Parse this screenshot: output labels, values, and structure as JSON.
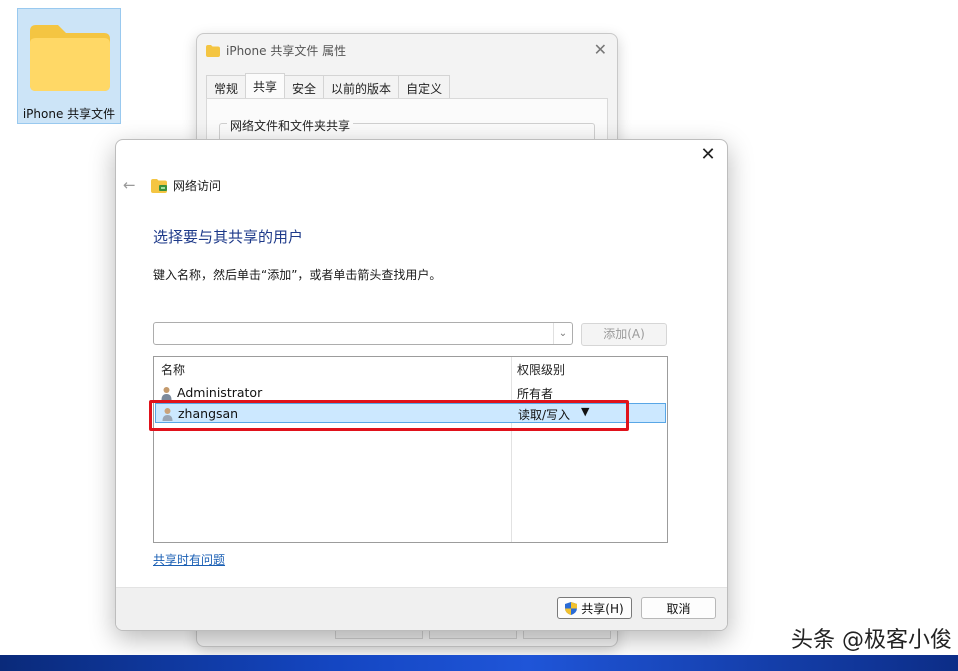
{
  "desktop": {
    "folder_label": "iPhone 共享文件"
  },
  "properties_dialog": {
    "title": "iPhone 共享文件 属性",
    "tabs": [
      "常规",
      "共享",
      "安全",
      "以前的版本",
      "自定义"
    ],
    "active_tab": "共享",
    "group_label": "网络文件和文件夹共享"
  },
  "wizard": {
    "breadcrumb": "网络访问",
    "heading": "选择要与其共享的用户",
    "instruction": "键入名称，然后单击“添加”，或者单击箭头查找用户。",
    "name_input_value": "",
    "add_button": "添加(A)",
    "columns": {
      "name": "名称",
      "permission": "权限级别"
    },
    "users": [
      {
        "name": "Administrator",
        "permission": "所有者"
      },
      {
        "name": "zhangsan",
        "permission": "读取/写入",
        "selected": true
      }
    ],
    "help_link": "共享时有问题",
    "share_button": "共享(H)",
    "cancel_button": "取消"
  },
  "watermark": {
    "text": "头条 @极客小俊"
  },
  "colors": {
    "highlight_box": "#e0121b",
    "selected_row": "#cce8ff",
    "heading": "#1e3a8a",
    "link": "#1a5fb4"
  }
}
